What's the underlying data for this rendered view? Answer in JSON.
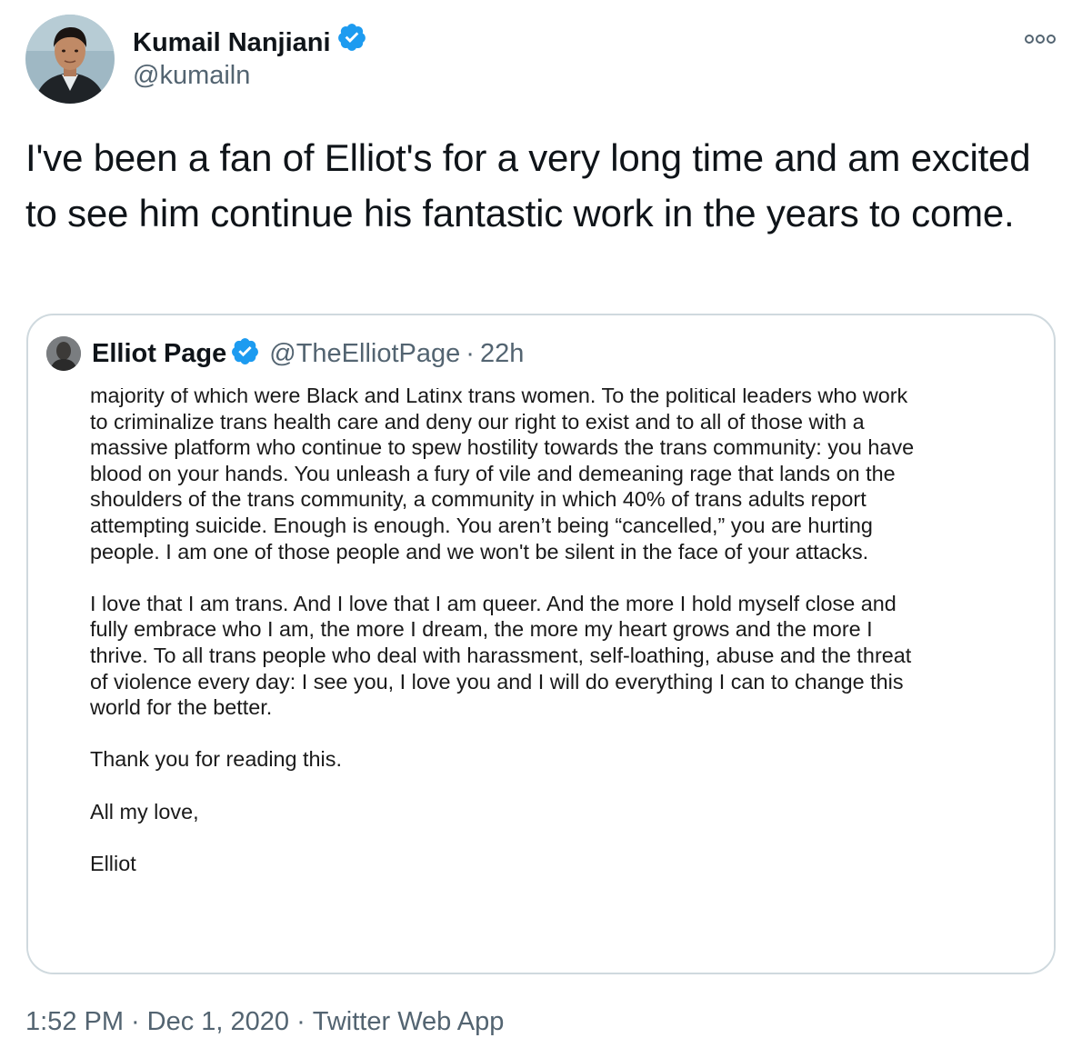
{
  "tweet": {
    "author": {
      "name": "Kumail Nanjiani",
      "handle": "@kumailn"
    },
    "text": "I've been a fan of Elliot's for a very long time and am excited to see him continue his fantastic work in the years to come.",
    "more_icon": "more-options-icon",
    "verified_icon": "verified-badge-icon",
    "timestamp": {
      "time": "1:52 PM",
      "date": "Dec 1, 2020",
      "source": "Twitter Web App",
      "separator": "·"
    }
  },
  "quote": {
    "author": {
      "name": "Elliot Page",
      "handle": "@TheElliotPage"
    },
    "separator": "·",
    "time": "22h",
    "image_letter": {
      "paragraphs": [
        [
          "majority of which were Black and Latinx trans women. To the political leaders who work",
          "to criminalize trans health care and deny our right to exist and to all of those with a",
          "massive platform who continue to spew hostility towards the trans community: you have",
          "blood on your hands. You unleash a fury of vile and demeaning rage that lands on the",
          "shoulders of the trans community, a community in which 40% of trans adults report",
          "attempting suicide. Enough is enough. You aren’t being “cancelled,” you are hurting",
          "people. I am one of those people and we won't be silent in the face of your attacks."
        ],
        [
          "I love that I am trans. And I love that I am queer. And the more I hold myself close and",
          "fully embrace who I am, the more I dream, the more my heart grows and the more I",
          "thrive. To all trans people who deal with harassment, self-loathing, abuse and the threat",
          "of violence every day: I see you, I love you and I will do everything I can to change this",
          "world for the better."
        ],
        [
          "Thank you for reading this."
        ],
        [
          "All my love,"
        ],
        [
          "Elliot"
        ]
      ]
    }
  },
  "colors": {
    "text": "#0f1419",
    "secondary": "#536471",
    "border": "#cfd9de",
    "verified": "#1d9bf0"
  }
}
